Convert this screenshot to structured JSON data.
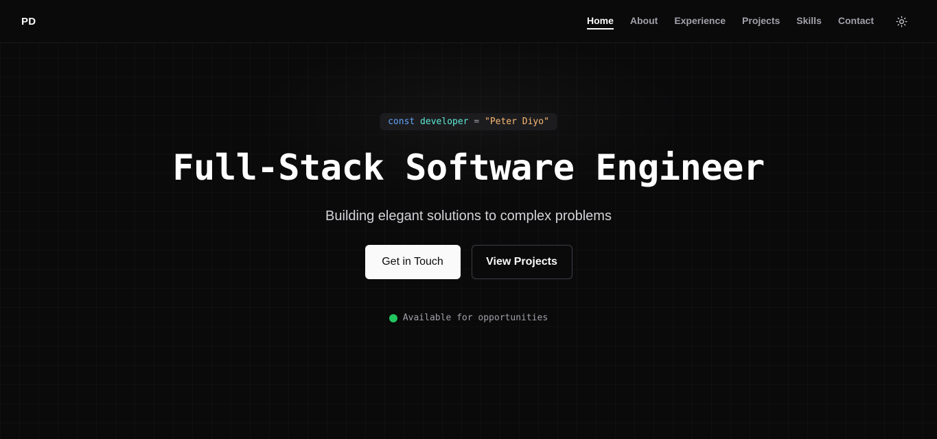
{
  "header": {
    "logo": "PD",
    "nav": [
      {
        "label": "Home",
        "active": true
      },
      {
        "label": "About"
      },
      {
        "label": "Experience"
      },
      {
        "label": "Projects"
      },
      {
        "label": "Skills"
      },
      {
        "label": "Contact"
      }
    ],
    "theme_toggle_icon": "sun-icon"
  },
  "hero": {
    "code": {
      "keyword": "const",
      "variable": "developer",
      "operator": "=",
      "string": "\"Peter Diyo\""
    },
    "title": "Full-Stack Software Engineer",
    "subtitle": "Building elegant solutions to complex problems",
    "primary_button": "Get in Touch",
    "secondary_button": "View Projects",
    "status": "Available for opportunities",
    "status_color": "#22c55e"
  },
  "colors": {
    "background": "#0a0a0b",
    "keyword": "#60a5fa",
    "variable": "#5eead4",
    "string": "#fdba74"
  }
}
